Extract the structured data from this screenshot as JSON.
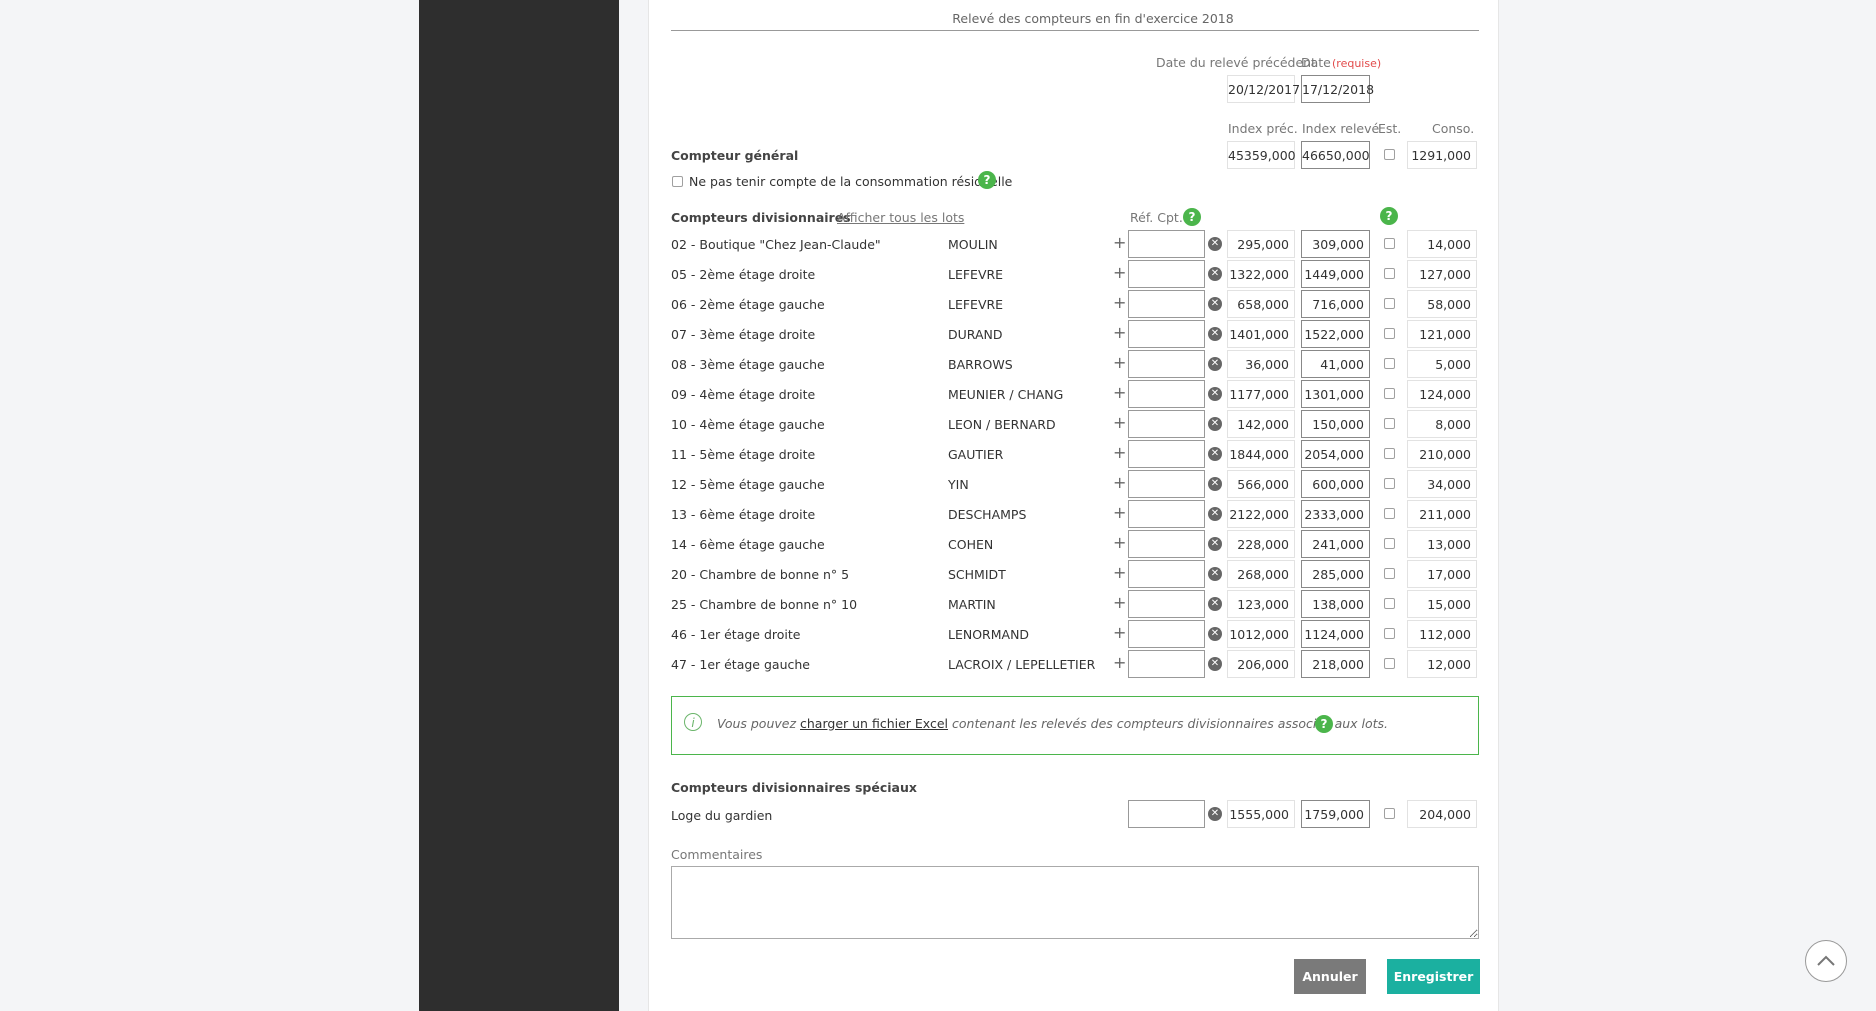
{
  "form": {
    "title": "Relevé des compteurs en fin d'exercice 2018",
    "prev_date_label": "Date du relevé précédent",
    "date_label": "Date",
    "required_label": "(requise)",
    "prev_date": "20/12/2017",
    "date": "17/12/2018",
    "col_index_prev": "Index préc.",
    "col_index_read": "Index relevé",
    "col_est": "Est.",
    "col_conso": "Conso.",
    "general": {
      "label": "Compteur général",
      "prev": "45359,000",
      "read": "46650,000",
      "conso": "1291,000"
    },
    "residual_label": "Ne pas tenir compte de la consommation résiduelle",
    "divisional_label": "Compteurs divisionnaires",
    "show_all_lots": "Afficher tous les lots",
    "ref_label": "Réf. Cpt.",
    "help_glyph": "?",
    "plus_glyph": "+",
    "clear_glyph": "✕",
    "rows": [
      {
        "lot": "02 - Boutique \"Chez Jean-Claude\"",
        "owner": "MOULIN",
        "prev": "295,000",
        "read": "309,000",
        "conso": "14,000"
      },
      {
        "lot": "05 - 2ème étage droite",
        "owner": "LEFEVRE",
        "prev": "1322,000",
        "read": "1449,000",
        "conso": "127,000"
      },
      {
        "lot": "06 - 2ème étage gauche",
        "owner": "LEFEVRE",
        "prev": "658,000",
        "read": "716,000",
        "conso": "58,000"
      },
      {
        "lot": "07 - 3ème étage droite",
        "owner": "DURAND",
        "prev": "1401,000",
        "read": "1522,000",
        "conso": "121,000"
      },
      {
        "lot": "08 - 3ème étage gauche",
        "owner": "BARROWS",
        "prev": "36,000",
        "read": "41,000",
        "conso": "5,000"
      },
      {
        "lot": "09 - 4ème étage droite",
        "owner": "MEUNIER / CHANG",
        "prev": "1177,000",
        "read": "1301,000",
        "conso": "124,000"
      },
      {
        "lot": "10 - 4ème étage gauche",
        "owner": "LEON / BERNARD",
        "prev": "142,000",
        "read": "150,000",
        "conso": "8,000"
      },
      {
        "lot": "11 - 5ème étage droite",
        "owner": "GAUTIER",
        "prev": "1844,000",
        "read": "2054,000",
        "conso": "210,000"
      },
      {
        "lot": "12 - 5ème étage gauche",
        "owner": "YIN",
        "prev": "566,000",
        "read": "600,000",
        "conso": "34,000"
      },
      {
        "lot": "13 - 6ème étage droite",
        "owner": "DESCHAMPS",
        "prev": "2122,000",
        "read": "2333,000",
        "conso": "211,000"
      },
      {
        "lot": "14 - 6ème étage gauche",
        "owner": "COHEN",
        "prev": "228,000",
        "read": "241,000",
        "conso": "13,000"
      },
      {
        "lot": "20 - Chambre de bonne n° 5",
        "owner": "SCHMIDT",
        "prev": "268,000",
        "read": "285,000",
        "conso": "17,000"
      },
      {
        "lot": "25 - Chambre de bonne n° 10",
        "owner": "MARTIN",
        "prev": "123,000",
        "read": "138,000",
        "conso": "15,000"
      },
      {
        "lot": "46 - 1er étage droite",
        "owner": "LENORMAND",
        "prev": "1012,000",
        "read": "1124,000",
        "conso": "112,000"
      },
      {
        "lot": "47 - 1er étage gauche",
        "owner": "LACROIX / LEPELLETIER",
        "prev": "206,000",
        "read": "218,000",
        "conso": "12,000"
      }
    ],
    "info": {
      "prefix": "Vous pouvez",
      "link": "charger un fichier Excel",
      "suffix": "contenant les relevés des compteurs divisionnaires associés aux lots.",
      "icon_glyph": "i"
    },
    "special": {
      "label": "Compteurs divisionnaires spéciaux",
      "row": {
        "lot": "Loge du gardien",
        "prev": "1555,000",
        "read": "1759,000",
        "conso": "204,000"
      }
    },
    "comments_label": "Commentaires",
    "cancel_label": "Annuler",
    "save_label": "Enregistrer"
  },
  "scroll_top_icon": "chevron-up-icon",
  "colors": {
    "accent": "#1bb0a0",
    "help": "#4bb54b",
    "sidebar": "#2e2e2e"
  }
}
